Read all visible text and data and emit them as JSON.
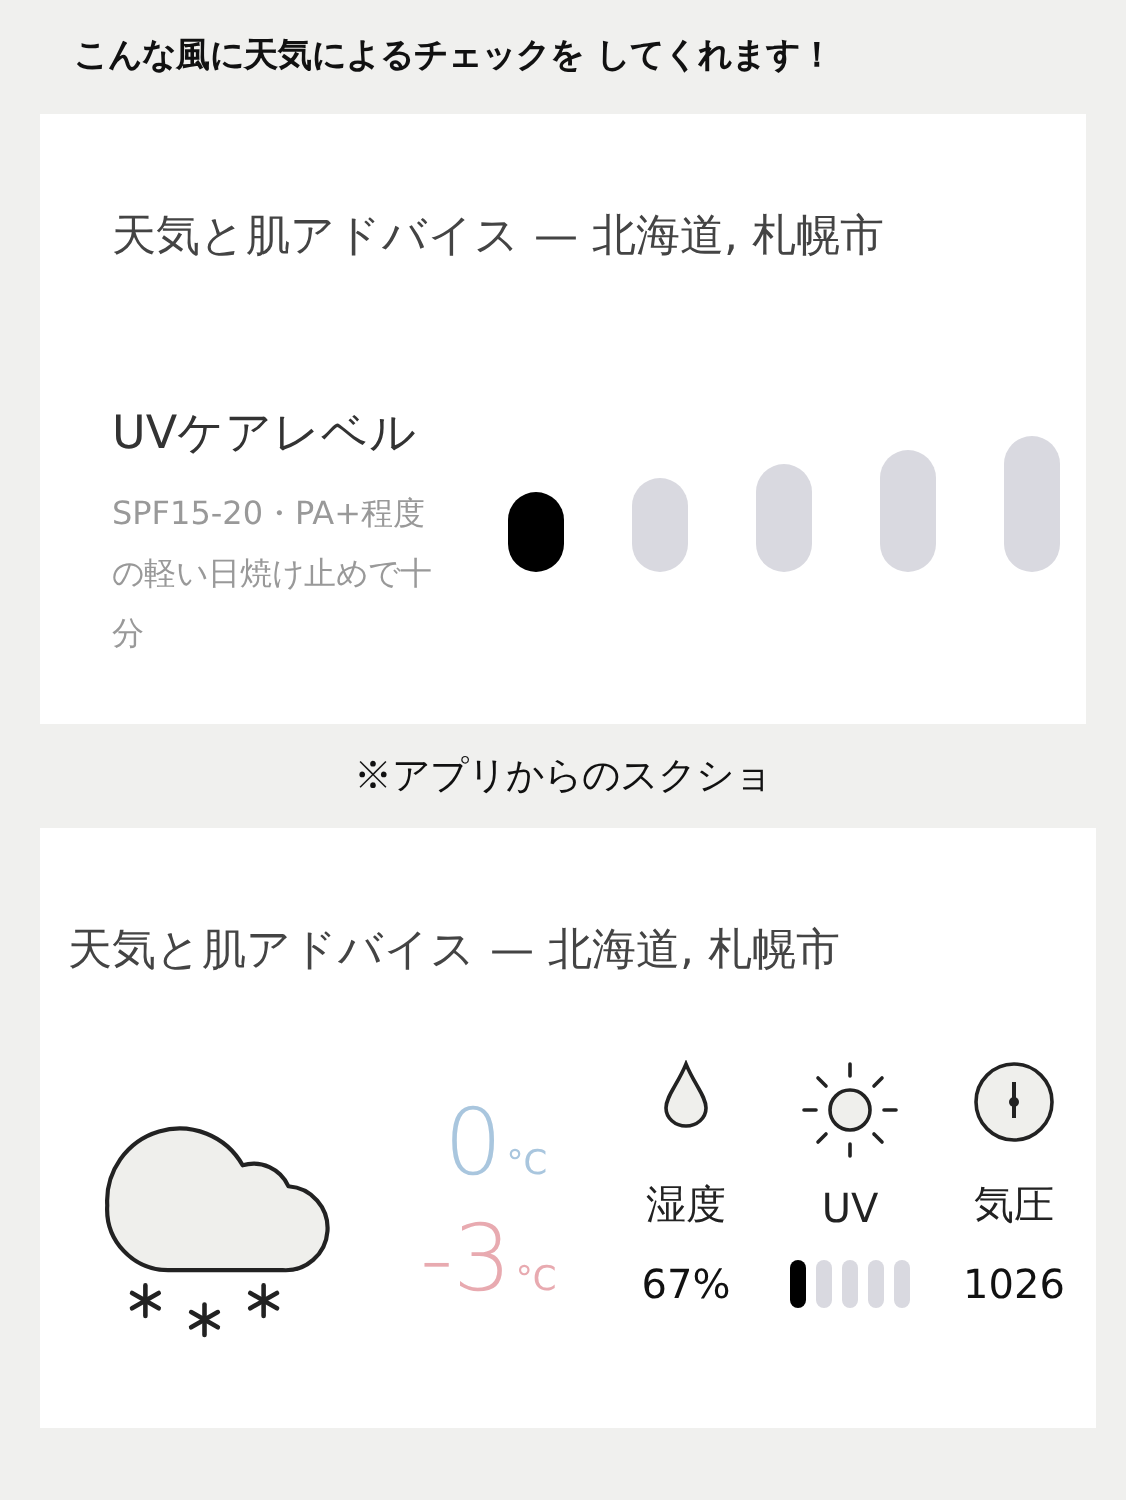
{
  "caption_top": "こんな風に天気によるチェックを してくれます！",
  "card_1": {
    "title": "天気と肌アドバイス — 北海道, 札幌市",
    "uv_care": {
      "heading": "UVケアレベル",
      "description": "SPF15-20・PA+程度の軽い日焼け止めで十分",
      "level": 0.2
    }
  },
  "caption_middle": "※アプリからのスクショ",
  "card_2": {
    "title": "天気と肌アドバイス — 北海道, 札幌市",
    "temperatures": [
      {
        "value": "0",
        "unit": "°C",
        "color": "#a9c6de"
      },
      {
        "value": "-3",
        "unit": "°C",
        "color": "#e8aab0"
      }
    ],
    "stats": [
      {
        "kind": "text",
        "label": "湿度",
        "value": "67%"
      },
      {
        "kind": "meter",
        "label": "UV",
        "level": 0.2
      },
      {
        "kind": "text",
        "label": "気圧",
        "value": "1026"
      }
    ]
  }
}
